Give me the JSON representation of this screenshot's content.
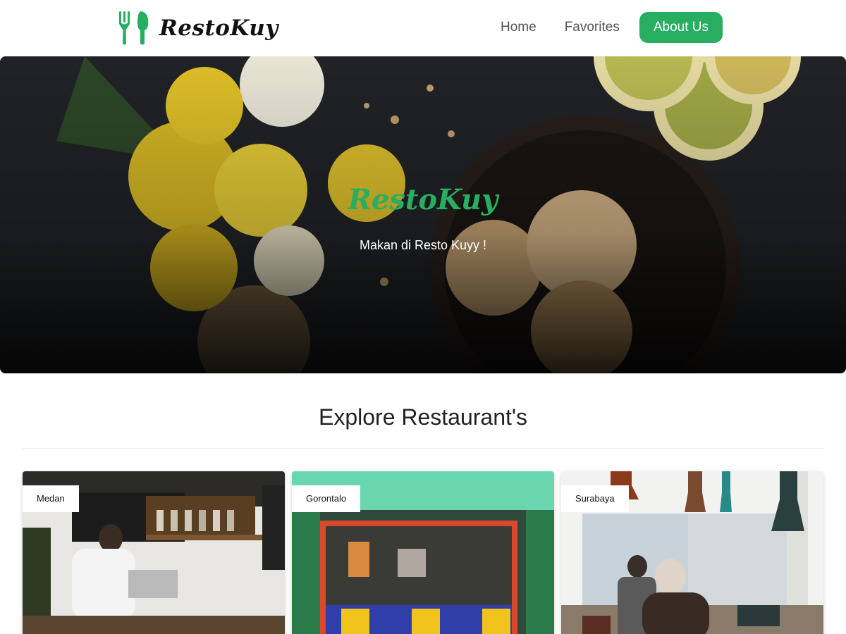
{
  "header": {
    "brand_name": "RestoKuy",
    "nav": [
      {
        "label": "Home"
      },
      {
        "label": "Favorites"
      },
      {
        "label": "About Us"
      }
    ],
    "brand_icon": "fork-spoon-icon",
    "accent_color": "#27ae60"
  },
  "hero": {
    "title": "RestoKuy",
    "subtitle": "Makan di Resto Kuyy !"
  },
  "explore": {
    "title": "Explore Restaurant's",
    "restaurants": [
      {
        "city": "Medan"
      },
      {
        "city": "Gorontalo"
      },
      {
        "city": "Surabaya"
      }
    ]
  }
}
